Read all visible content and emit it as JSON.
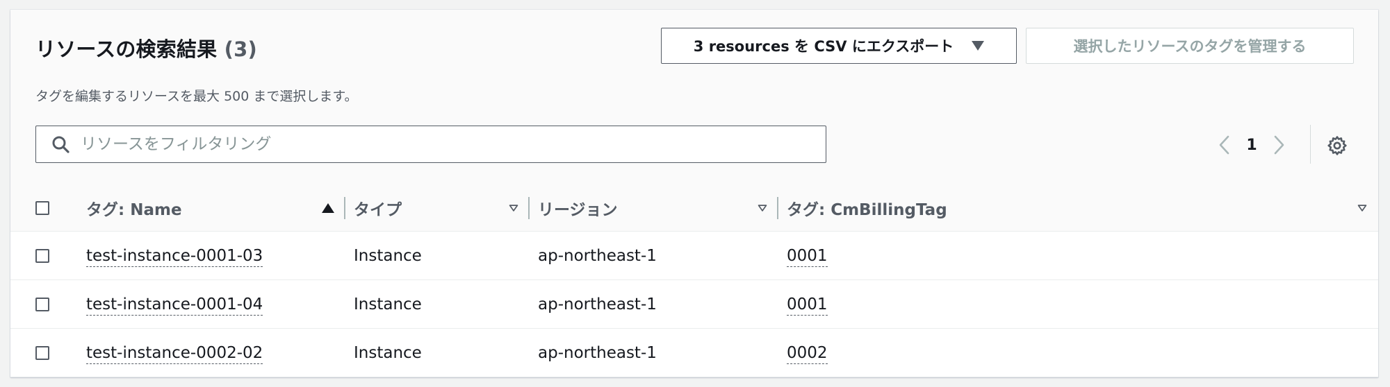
{
  "header": {
    "title": "リソースの検索結果",
    "count": "(3)",
    "subtitle": "タグを編集するリソースを最大 500 まで選択します。",
    "export_button": "3 resources を CSV にエクスポート",
    "manage_button": "選択したリソースのタグを管理する"
  },
  "search": {
    "placeholder": "リソースをフィルタリング",
    "value": ""
  },
  "pagination": {
    "current_page": "1"
  },
  "table": {
    "columns": [
      {
        "label": "タグ: Name",
        "sort": "ascending"
      },
      {
        "label": "タイプ",
        "sort": "none"
      },
      {
        "label": "リージョン",
        "sort": "none"
      },
      {
        "label": "タグ: CmBillingTag",
        "sort": "none"
      }
    ],
    "rows": [
      {
        "name": "test-instance-0001-03",
        "type": "Instance",
        "region": "ap-northeast-1",
        "billing_tag": "0001"
      },
      {
        "name": "test-instance-0001-04",
        "type": "Instance",
        "region": "ap-northeast-1",
        "billing_tag": "0001"
      },
      {
        "name": "test-instance-0002-02",
        "type": "Instance",
        "region": "ap-northeast-1",
        "billing_tag": "0002"
      }
    ]
  },
  "icons": {
    "search": "search-icon",
    "prev": "chevron-left-icon",
    "next": "chevron-right-icon",
    "settings": "gear-icon"
  },
  "colors": {
    "text": "#16191f",
    "secondary_text": "#545b64",
    "disabled_text": "#95a5a6",
    "border": "#eaeded"
  }
}
